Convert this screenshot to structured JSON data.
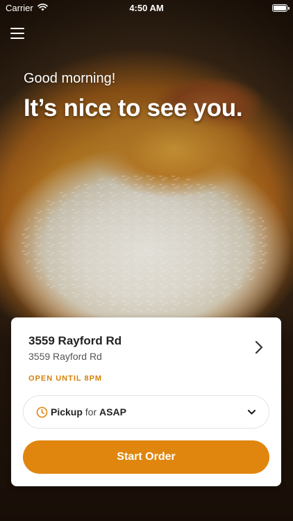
{
  "status_bar": {
    "carrier": "Carrier",
    "time": "4:50 AM"
  },
  "header": {
    "menu_icon": "hamburger-menu-icon"
  },
  "hero": {
    "greeting": "Good morning!",
    "headline": "It’s nice to see you."
  },
  "location": {
    "name": "3559 Rayford Rd",
    "address": "3559 Rayford Rd",
    "hours": "OPEN UNTIL 8PM"
  },
  "order_mode": {
    "mode": "Pickup",
    "connector": "for",
    "time": "ASAP"
  },
  "actions": {
    "start_label": "Start Order"
  },
  "colors": {
    "accent": "#e0860e",
    "hours_text": "#d4820c"
  }
}
